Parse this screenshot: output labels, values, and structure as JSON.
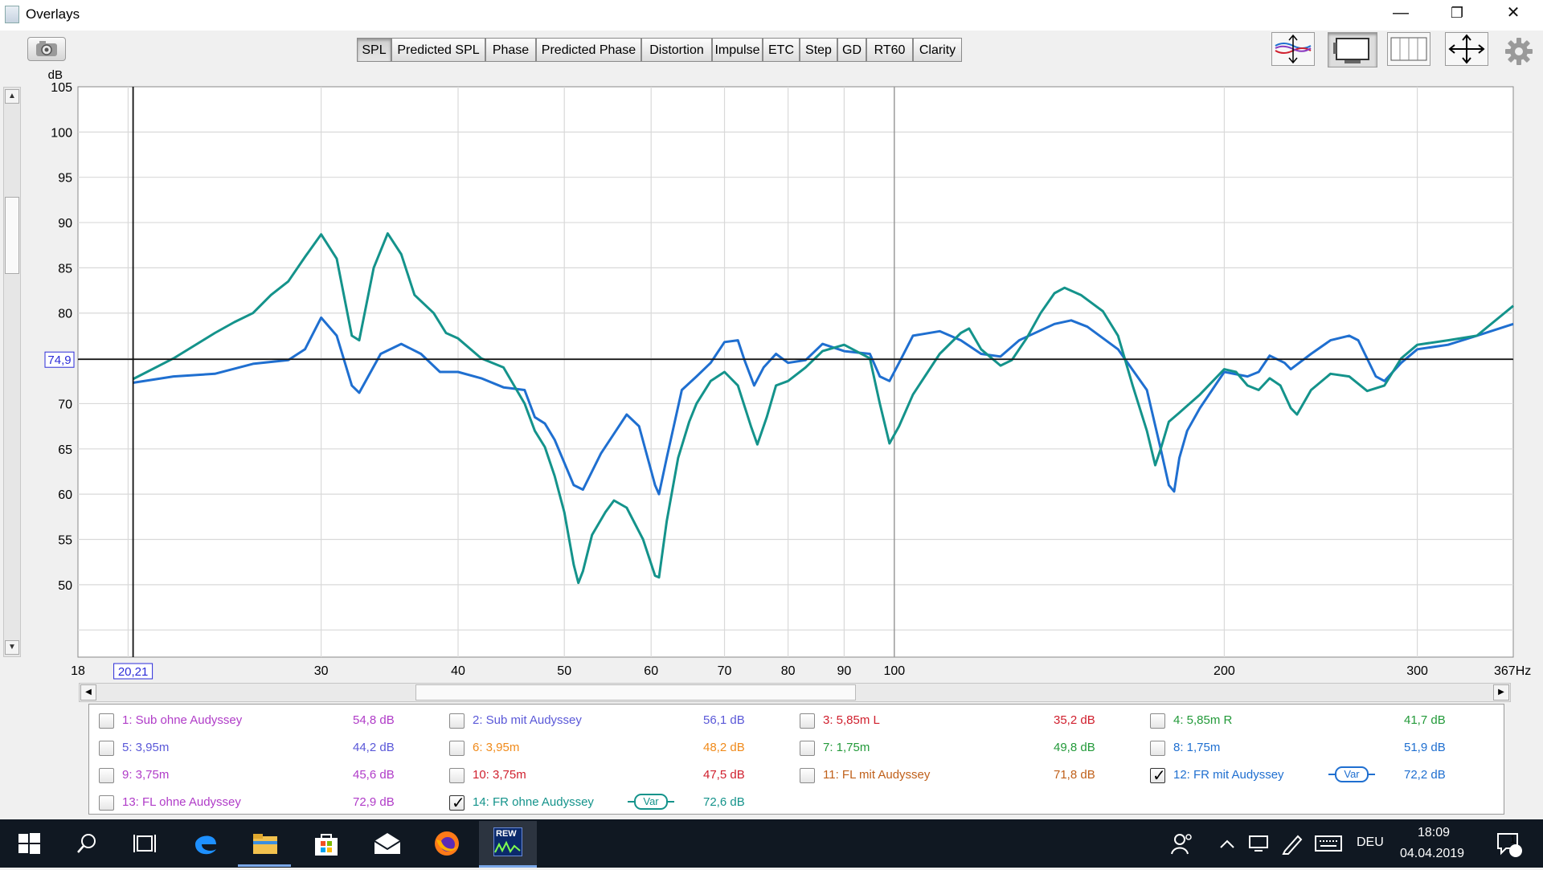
{
  "window": {
    "title": "Overlays",
    "minimize_glyph": "—",
    "restore_glyph": "❐",
    "close_glyph": "✕"
  },
  "tabs": [
    {
      "label": "SPL",
      "active": true
    },
    {
      "label": "Predicted SPL"
    },
    {
      "label": "Phase"
    },
    {
      "label": "Predicted Phase"
    },
    {
      "label": "Distortion"
    },
    {
      "label": "Impulse"
    },
    {
      "label": "ETC"
    },
    {
      "label": "Step"
    },
    {
      "label": "GD"
    },
    {
      "label": "RT60"
    },
    {
      "label": "Clarity"
    }
  ],
  "right_tools": [
    {
      "icon": "vertical-limits-icon"
    },
    {
      "icon": "controls-layout-icon",
      "active": true
    },
    {
      "icon": "columns-icon"
    },
    {
      "icon": "fit-all-icon"
    },
    {
      "icon": "gear-icon"
    }
  ],
  "graph": {
    "y_unit": "dB",
    "x_unit": "Hz",
    "cursor_x_label": "20,21",
    "cursor_y_label": "74,9",
    "cursor_x": 20.21,
    "cursor_y": 74.9,
    "x_min": 18,
    "x_max": 367,
    "y_min": 42,
    "y_max": 105,
    "y_ticks": [
      "105",
      "100",
      "95",
      "90",
      "85",
      "80",
      "70",
      "65",
      "60",
      "55",
      "50"
    ],
    "x_ticks": [
      {
        "v": 18,
        "label": "18"
      },
      {
        "v": 30,
        "label": "30"
      },
      {
        "v": 40,
        "label": "40"
      },
      {
        "v": 50,
        "label": "50"
      },
      {
        "v": 60,
        "label": "60"
      },
      {
        "v": 70,
        "label": "70"
      },
      {
        "v": 80,
        "label": "80"
      },
      {
        "v": 90,
        "label": "90"
      },
      {
        "v": 100,
        "label": "100"
      },
      {
        "v": 200,
        "label": "200"
      },
      {
        "v": 300,
        "label": "300"
      },
      {
        "v": 367,
        "label": "367Hz"
      }
    ]
  },
  "chart_data": {
    "type": "line",
    "xlabel": "Hz",
    "ylabel": "dB",
    "x_scale": "log",
    "xlim": [
      18,
      367
    ],
    "ylim": [
      42,
      105
    ],
    "grid": true,
    "series": [
      {
        "name": "12: FR mit Audyssey",
        "color": "#1f6fd0",
        "points": [
          [
            20.2,
            72.3
          ],
          [
            22,
            73
          ],
          [
            24,
            73.3
          ],
          [
            26,
            74.4
          ],
          [
            28,
            74.8
          ],
          [
            29,
            76
          ],
          [
            30,
            79.5
          ],
          [
            31,
            77.5
          ],
          [
            32,
            72
          ],
          [
            32.5,
            71.2
          ],
          [
            34,
            75.5
          ],
          [
            35.5,
            76.6
          ],
          [
            37,
            75.5
          ],
          [
            38.5,
            73.5
          ],
          [
            40,
            73.5
          ],
          [
            42,
            72.8
          ],
          [
            44,
            71.8
          ],
          [
            46,
            71.5
          ],
          [
            47,
            68.5
          ],
          [
            48,
            67.8
          ],
          [
            49,
            66
          ],
          [
            51,
            61
          ],
          [
            52,
            60.5
          ],
          [
            54,
            64.5
          ],
          [
            57,
            68.8
          ],
          [
            58.5,
            67.5
          ],
          [
            60.5,
            61
          ],
          [
            61,
            60
          ],
          [
            62,
            64
          ],
          [
            64,
            71.5
          ],
          [
            66,
            73
          ],
          [
            68,
            74.5
          ],
          [
            70,
            76.8
          ],
          [
            72,
            77
          ],
          [
            73,
            74.8
          ],
          [
            74.5,
            72
          ],
          [
            76,
            74
          ],
          [
            78,
            75.5
          ],
          [
            80,
            74.5
          ],
          [
            83,
            74.8
          ],
          [
            86,
            76.6
          ],
          [
            90,
            75.8
          ],
          [
            95,
            75.5
          ],
          [
            97,
            73
          ],
          [
            99,
            72.5
          ],
          [
            101,
            74.5
          ],
          [
            104,
            77.5
          ],
          [
            110,
            78
          ],
          [
            115,
            77
          ],
          [
            120,
            75.5
          ],
          [
            125,
            75.2
          ],
          [
            130,
            77
          ],
          [
            140,
            78.8
          ],
          [
            145,
            79.2
          ],
          [
            150,
            78.5
          ],
          [
            160,
            76
          ],
          [
            170,
            71.5
          ],
          [
            175,
            65
          ],
          [
            178,
            61
          ],
          [
            180,
            60.3
          ],
          [
            182,
            64
          ],
          [
            185,
            67
          ],
          [
            190,
            69.5
          ],
          [
            200,
            73.5
          ],
          [
            210,
            73
          ],
          [
            215,
            73.5
          ],
          [
            220,
            75.3
          ],
          [
            227,
            74.5
          ],
          [
            230,
            73.8
          ],
          [
            240,
            75.5
          ],
          [
            250,
            77
          ],
          [
            260,
            77.5
          ],
          [
            265,
            77
          ],
          [
            275,
            73
          ],
          [
            280,
            72.5
          ],
          [
            290,
            74.5
          ],
          [
            300,
            76
          ],
          [
            320,
            76.5
          ],
          [
            340,
            77.5
          ],
          [
            367,
            78.8
          ]
        ]
      },
      {
        "name": "14: FR ohne Audyssey",
        "color": "#14938b",
        "points": [
          [
            20.2,
            72.7
          ],
          [
            22,
            75
          ],
          [
            24,
            77.8
          ],
          [
            25,
            79
          ],
          [
            26,
            80
          ],
          [
            27,
            82
          ],
          [
            28,
            83.5
          ],
          [
            29,
            86.2
          ],
          [
            30,
            88.7
          ],
          [
            31,
            86
          ],
          [
            32,
            77.5
          ],
          [
            32.5,
            77
          ],
          [
            33.5,
            85
          ],
          [
            34.5,
            88.8
          ],
          [
            35.5,
            86.5
          ],
          [
            36.5,
            82
          ],
          [
            38,
            80
          ],
          [
            39,
            77.8
          ],
          [
            40,
            77.2
          ],
          [
            42,
            75
          ],
          [
            44,
            74
          ],
          [
            46,
            70
          ],
          [
            47,
            67
          ],
          [
            48,
            65.2
          ],
          [
            49,
            62
          ],
          [
            50,
            58
          ],
          [
            51,
            52.2
          ],
          [
            51.5,
            50.2
          ],
          [
            52,
            51.5
          ],
          [
            53,
            55.5
          ],
          [
            54.5,
            58
          ],
          [
            55.5,
            59.3
          ],
          [
            57,
            58.5
          ],
          [
            59,
            55
          ],
          [
            60.5,
            51
          ],
          [
            61,
            50.8
          ],
          [
            62,
            57
          ],
          [
            63.5,
            64
          ],
          [
            65,
            68
          ],
          [
            66,
            70
          ],
          [
            68,
            72.5
          ],
          [
            70,
            73.5
          ],
          [
            72,
            72
          ],
          [
            74,
            67.5
          ],
          [
            75,
            65.5
          ],
          [
            76.5,
            68.5
          ],
          [
            78,
            72
          ],
          [
            80,
            72.5
          ],
          [
            83,
            74
          ],
          [
            86,
            75.8
          ],
          [
            90,
            76.5
          ],
          [
            95,
            75
          ],
          [
            97,
            70
          ],
          [
            99,
            65.6
          ],
          [
            101,
            67.5
          ],
          [
            104,
            71
          ],
          [
            110,
            75.5
          ],
          [
            115,
            77.8
          ],
          [
            117,
            78.3
          ],
          [
            120,
            76
          ],
          [
            125,
            74.2
          ],
          [
            128,
            74.8
          ],
          [
            132,
            77.2
          ],
          [
            136,
            80
          ],
          [
            140,
            82.2
          ],
          [
            143,
            82.8
          ],
          [
            148,
            82
          ],
          [
            155,
            80.2
          ],
          [
            160,
            77.5
          ],
          [
            165,
            72
          ],
          [
            170,
            67
          ],
          [
            173,
            63.2
          ],
          [
            175,
            65
          ],
          [
            178,
            68
          ],
          [
            182,
            69
          ],
          [
            190,
            71
          ],
          [
            200,
            73.8
          ],
          [
            205,
            73.5
          ],
          [
            210,
            72
          ],
          [
            215,
            71.5
          ],
          [
            220,
            72.8
          ],
          [
            225,
            72
          ],
          [
            230,
            69.5
          ],
          [
            233,
            68.8
          ],
          [
            240,
            71.5
          ],
          [
            250,
            73.3
          ],
          [
            260,
            73
          ],
          [
            270,
            71.4
          ],
          [
            280,
            72
          ],
          [
            290,
            75
          ],
          [
            300,
            76.5
          ],
          [
            320,
            77
          ],
          [
            340,
            77.5
          ],
          [
            367,
            80.8
          ]
        ]
      }
    ]
  },
  "legend": [
    {
      "col": 0,
      "row": 0,
      "label": "1: Sub ohne Audyssey",
      "value": "54,8 dB",
      "color": "#b03cc8",
      "checked": false
    },
    {
      "col": 1,
      "row": 0,
      "label": "2: Sub mit Audyssey",
      "value": "56,1 dB",
      "color": "#5a58d8",
      "checked": false
    },
    {
      "col": 2,
      "row": 0,
      "label": "3: 5,85m L",
      "value": "35,2 dB",
      "color": "#d0202e",
      "checked": false
    },
    {
      "col": 3,
      "row": 0,
      "label": "4: 5,85m R",
      "value": "41,7 dB",
      "color": "#239a3a",
      "checked": false
    },
    {
      "col": 0,
      "row": 1,
      "label": "5: 3,95m",
      "value": "44,2 dB",
      "color": "#5a58d8",
      "checked": false
    },
    {
      "col": 1,
      "row": 1,
      "label": "6: 3,95m",
      "value": "48,2 dB",
      "color": "#f08a1a",
      "checked": false
    },
    {
      "col": 2,
      "row": 1,
      "label": "7: 1,75m",
      "value": "49,8 dB",
      "color": "#239a3a",
      "checked": false
    },
    {
      "col": 3,
      "row": 1,
      "label": "8: 1,75m",
      "value": "51,9 dB",
      "color": "#1f6fd0",
      "checked": false
    },
    {
      "col": 0,
      "row": 2,
      "label": "9: 3,75m",
      "value": "45,6 dB",
      "color": "#b03cc8",
      "checked": false
    },
    {
      "col": 1,
      "row": 2,
      "label": "10: 3,75m",
      "value": "47,5 dB",
      "color": "#d0202e",
      "checked": false
    },
    {
      "col": 2,
      "row": 2,
      "label": "11: FL mit Audyssey",
      "value": "71,8 dB",
      "color": "#c0601a",
      "checked": false
    },
    {
      "col": 3,
      "row": 2,
      "label": "12: FR mit Audyssey",
      "value": "72,2 dB",
      "color": "#1f6fd0",
      "checked": true,
      "var": "Var"
    },
    {
      "col": 0,
      "row": 3,
      "label": "13: FL ohne Audyssey",
      "value": "72,9 dB",
      "color": "#b03cc8",
      "checked": false
    },
    {
      "col": 1,
      "row": 3,
      "label": "14: FR ohne Audyssey",
      "value": "72,6 dB",
      "color": "#14938b",
      "checked": true,
      "var": "Var"
    }
  ],
  "taskbar": {
    "time": "18:09",
    "date": "04.04.2019",
    "lang": "DEU",
    "notifications": "1",
    "rew_label": "REW"
  }
}
